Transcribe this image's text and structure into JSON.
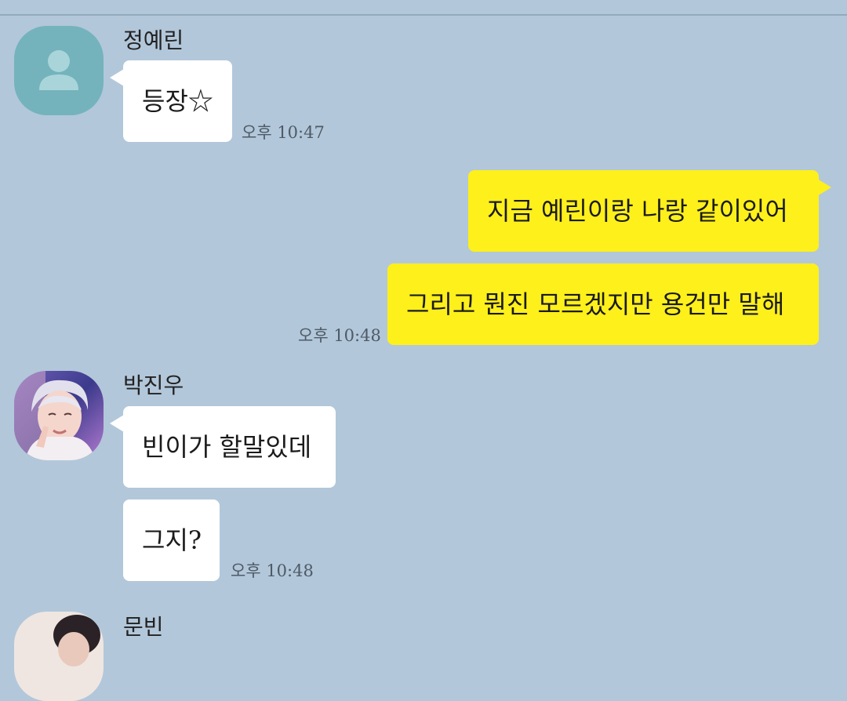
{
  "messages": {
    "m1": {
      "sender": "정예린",
      "text": "등장☆",
      "time": "오후 10:47"
    },
    "m2": {
      "text": "지금 예린이랑 나랑 같이있어"
    },
    "m3": {
      "text": "그리고 뭔진 모르겠지만 용건만 말해",
      "time": "오후 10:48"
    },
    "m4": {
      "sender": "박진우",
      "text": "빈이가 할말있데"
    },
    "m5": {
      "text": "그지?",
      "time": "오후 10:48"
    },
    "m6": {
      "sender": "문빈"
    }
  },
  "colors": {
    "background": "#b2c7da",
    "outgoing_bubble": "#fef01b",
    "incoming_bubble": "#ffffff",
    "default_avatar": "#74b3bc"
  },
  "icons": {
    "default_avatar": "person-silhouette-icon"
  }
}
